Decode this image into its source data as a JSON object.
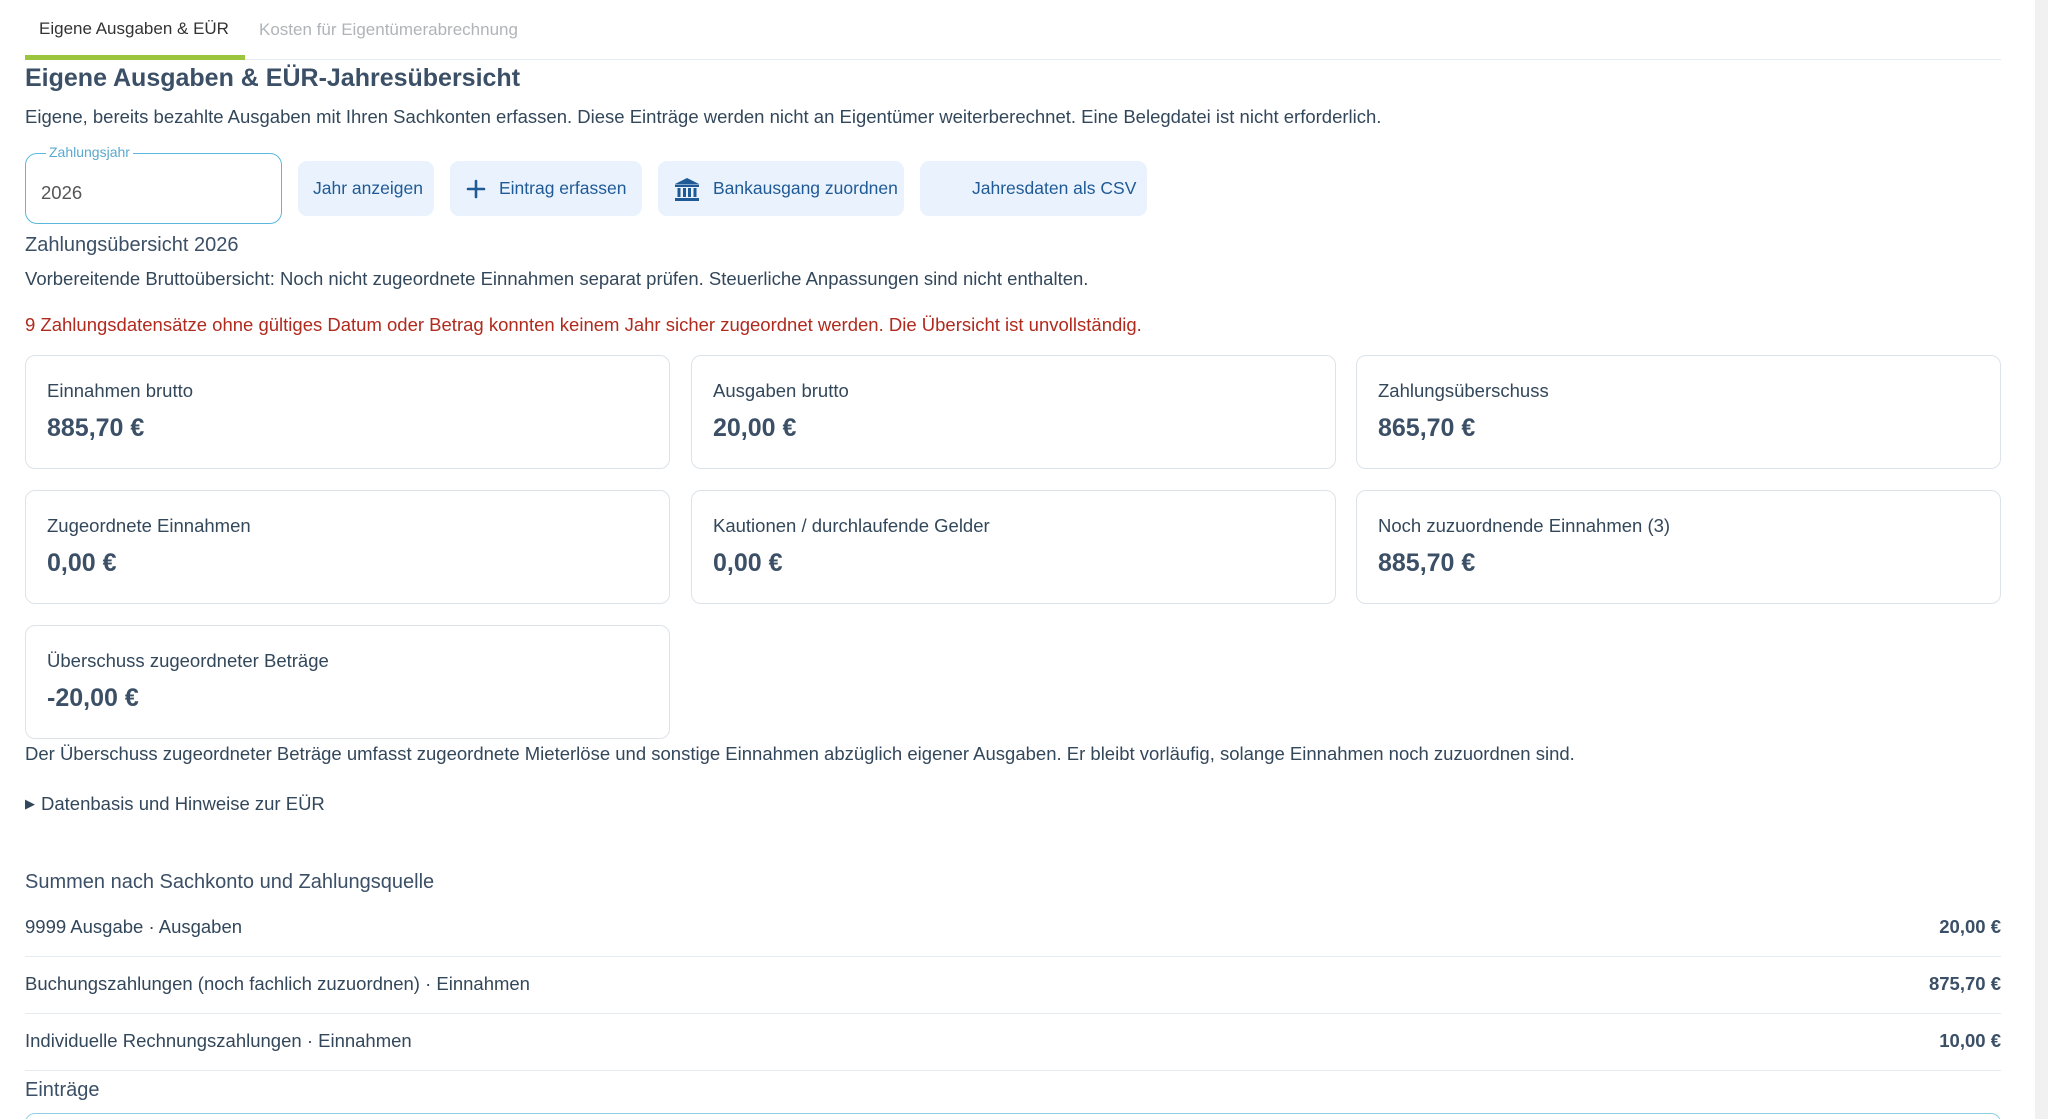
{
  "tabs": {
    "active": "Eigene Ausgaben & EÜR",
    "inactive": "Kosten für Eigentümerabrechnung"
  },
  "page": {
    "title": "Eigene Ausgaben & EÜR-Jahresübersicht",
    "intro": "Eigene, bereits bezahlte Ausgaben mit Ihren Sachkonten erfassen. Diese Einträge werden nicht an Eigentümer weiterberechnet. Eine Belegdatei ist nicht erforderlich."
  },
  "year_field": {
    "label": "Zahlungsjahr",
    "value": "2026"
  },
  "actions": {
    "show_year": "Jahr anzeigen",
    "add_entry": "Eintrag erfassen",
    "assign_bank": "Bankausgang zuordnen",
    "csv": "Jahresdaten als CSV"
  },
  "overview": {
    "title": "Zahlungsübersicht 2026",
    "subtitle": "Vorbereitende Bruttoübersicht: Noch nicht zugeordnete Einnahmen separat prüfen. Steuerliche Anpassungen sind nicht enthalten.",
    "warning": "9 Zahlungsdatensätze ohne gültiges Datum oder Betrag konnten keinem Jahr sicher zugeordnet werden. Die Übersicht ist unvollständig."
  },
  "cards": [
    {
      "label": "Einnahmen brutto",
      "value": "885,70 €"
    },
    {
      "label": "Ausgaben brutto",
      "value": "20,00 €"
    },
    {
      "label": "Zahlungsüberschuss",
      "value": "865,70 €"
    },
    {
      "label": "Zugeordnete Einnahmen",
      "value": "0,00 €"
    },
    {
      "label": "Kautionen / durchlaufende Gelder",
      "value": "0,00 €"
    },
    {
      "label": "Noch zuzuordnende Einnahmen (3)",
      "value": "885,70 €"
    },
    {
      "label": "Überschuss zugeordneter Beträge",
      "value": "-20,00 €"
    }
  ],
  "note": "Der Überschuss zugeordneter Beträge umfasst zugeordnete Mieterlöse und sonstige Einnahmen abzüglich eigener Ausgaben. Er bleibt vorläufig, solange Einnahmen noch zuzuordnen sind.",
  "details_summary": "Datenbasis und Hinweise zur EÜR",
  "sums": {
    "title": "Summen nach Sachkonto und Zahlungsquelle",
    "rows": [
      {
        "label": "9999 Ausgabe · Ausgaben",
        "amount": "20,00 €"
      },
      {
        "label": "Buchungszahlungen (noch fachlich zuzuordnen) · Einnahmen",
        "amount": "875,70 €"
      },
      {
        "label": "Individuelle Rechnungszahlungen · Einnahmen",
        "amount": "10,00 €"
      }
    ]
  },
  "entries_title": "Einträge",
  "colors": {
    "accent_green": "#9bc53d",
    "button_bg": "#eaf3fd",
    "button_text": "#1f5a96",
    "warning": "#b02a1e"
  }
}
